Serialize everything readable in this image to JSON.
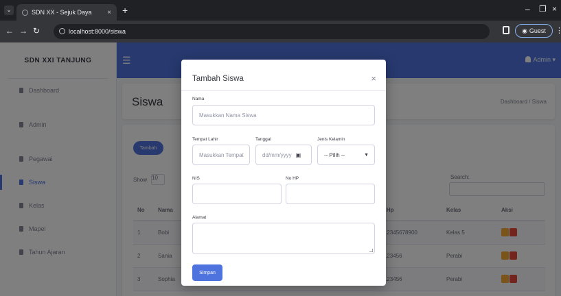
{
  "browser": {
    "tab_title": "SDN XX - Sejuk Daya",
    "tab_close": "×",
    "new_tab": "+",
    "url": "localhost:8000/siswa",
    "profile_label": "Guest",
    "window_controls": [
      "–",
      "❐",
      "×"
    ]
  },
  "sidebar": {
    "brand": "SDN XXI TANJUNG",
    "items": [
      {
        "label": "Dashboard",
        "icon": "dashboard-icon"
      },
      {
        "label": "Admin",
        "icon": "admin-icon"
      },
      {
        "label": "Pegawai",
        "icon": "pegawai-icon"
      },
      {
        "label": "Siswa",
        "icon": "siswa-icon",
        "active": true
      },
      {
        "label": "Kelas",
        "icon": "kelas-icon"
      },
      {
        "label": "Mapel",
        "icon": "mapel-icon"
      },
      {
        "label": "Tahun Ajaran",
        "icon": "tahun-ajaran-icon"
      }
    ]
  },
  "topbar": {
    "menu_icon": "☰",
    "user_label": "Admin ▾"
  },
  "header": {
    "title": "Siswa",
    "breadcrumb": "Dashboard / Siswa"
  },
  "content": {
    "add_button": "Tambah",
    "show_label": "Show",
    "show_value": "10",
    "search_label": "Search:",
    "table": {
      "columns": [
        "No",
        "Nama",
        "No Hp",
        "Kelas",
        "Aksi"
      ],
      "rows": [
        {
          "no": "1",
          "nama": "Bobi",
          "hp": "0812345678900",
          "kelas": "Kelas 5"
        },
        {
          "no": "2",
          "nama": "Sania",
          "hp": "08123456",
          "kelas": "Perabi"
        },
        {
          "no": "3",
          "nama": "Sophia",
          "hp": "08123456",
          "kelas": "Perabi"
        }
      ]
    }
  },
  "modal": {
    "title": "Tambah Siswa",
    "close": "×",
    "fields": {
      "nama": {
        "label": "Nama",
        "placeholder": "Masukkan Nama Siswa"
      },
      "tempat_lahir": {
        "label": "Tempat Lahir",
        "placeholder": "Masukkan Tempat"
      },
      "tanggal": {
        "label": "Tanggal",
        "placeholder": "dd/mm/yyyy"
      },
      "jenis_kelamin": {
        "label": "Jenis Kelamin",
        "value": "-- Pilih --"
      },
      "nis": {
        "label": "NIS",
        "value": ""
      },
      "no_hp": {
        "label": "No HP",
        "value": ""
      },
      "alamat": {
        "label": "Alamat",
        "value": ""
      }
    },
    "save_button": "Simpan"
  },
  "colors": {
    "primary": "#4e73df",
    "warning": "#f6a934",
    "danger": "#e74a3b"
  }
}
